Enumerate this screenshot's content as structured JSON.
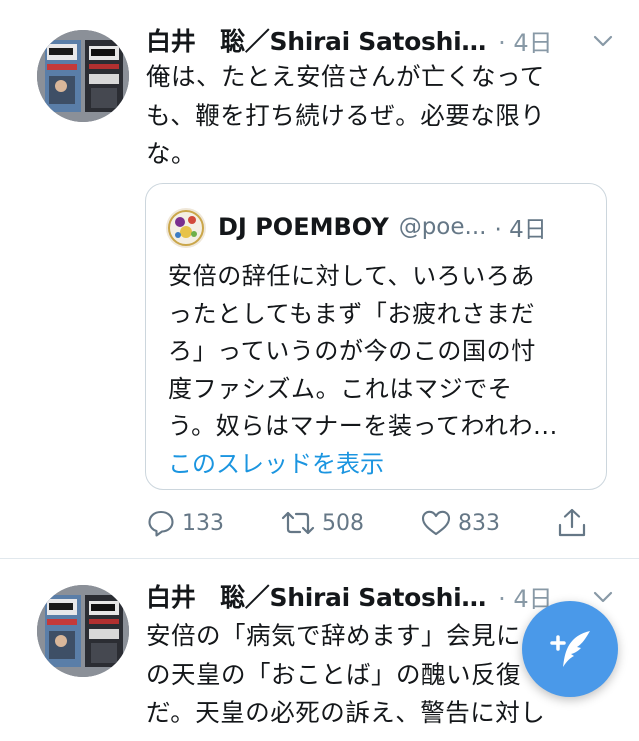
{
  "tweets": [
    {
      "author_name": "白井　聡／Shirai Satoshi…",
      "time": "· 4日",
      "text": "俺は、たとえ安倍さんが亡くなって\nも、鞭を打ち続けるぜ。必要な限り\nな。",
      "avatar_icon": "book-cover-avatar",
      "quote": {
        "author_name": "DJ POEMBOY",
        "handle": "@poe...",
        "time": "· 4日",
        "text": "安倍の辞任に対して、いろいろあ\nったとしてもまず「お疲れさまだ\nろ」っていうのが今のこの国の忖\n度ファシズム。これはマジでそ\nう。奴らはマナーを装ってわれわ...",
        "show_thread": "このスレッドを表示"
      },
      "actions": {
        "reply_count": "133",
        "retweet_count": "508",
        "like_count": "833"
      }
    },
    {
      "author_name": "白井　聡／Shirai Satoshi…",
      "time": "· 4日",
      "text": "安倍の「病気で辞めます」会見に\nの天皇の「おことば」の醜い反復\nだ。天皇の必死の訴え、警告に対し",
      "avatar_icon": "book-cover-avatar"
    }
  ],
  "compose_button": {
    "icon": "compose-tweet-icon"
  },
  "colors": {
    "accent": "#1b95e0",
    "fab": "#4a99e9",
    "secondary_text": "#657786",
    "border": "#ccd6dd"
  }
}
